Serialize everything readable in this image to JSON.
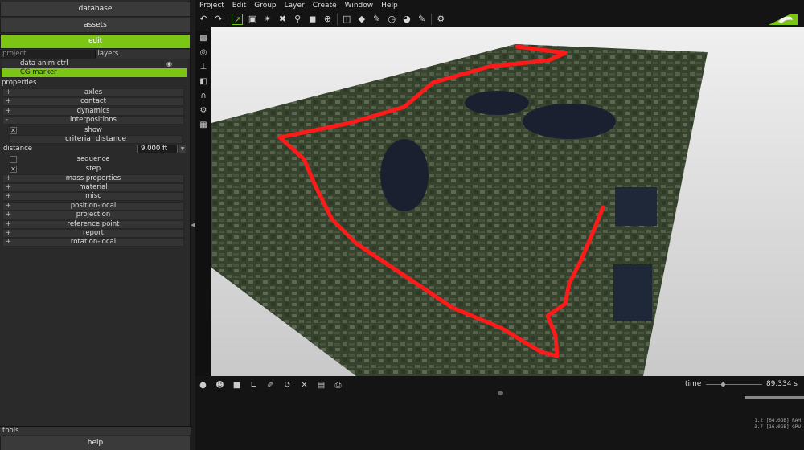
{
  "left_panel": {
    "database": "database",
    "assets": "assets",
    "edit": "edit",
    "tabs": {
      "project": "project",
      "layers": "layers"
    },
    "tree": [
      {
        "label": "data anim ctrl"
      },
      {
        "label": "CG marker"
      }
    ],
    "properties_label": "properties",
    "props": {
      "axles": "axles",
      "contact": "contact",
      "dynamics": "dynamics",
      "interpositions": "interpositions",
      "show": "show",
      "criteria": "criteria: distance",
      "distance_label": "distance",
      "distance_value": "9.000 ft",
      "sequence": "sequence",
      "step": "step",
      "mass_properties": "mass properties",
      "material": "material",
      "misc": "misc",
      "position_local": "position-local",
      "projection": "projection",
      "reference_point": "reference point",
      "report": "report",
      "rotation_local": "rotation-local"
    },
    "tools_label": "tools",
    "help": "help"
  },
  "menu": [
    "Project",
    "Edit",
    "Group",
    "Layer",
    "Create",
    "Window",
    "Help"
  ],
  "timeline": {
    "time_label": "time",
    "time_value": "89.334 s",
    "slider_fraction": 0.27
  },
  "memory": {
    "ram": "1.2 [64.0GB] RAM",
    "gpu": "3.7 [16.0GB] GPU"
  },
  "colors": {
    "accent": "#7bc614",
    "track": "#ff1a1a"
  }
}
